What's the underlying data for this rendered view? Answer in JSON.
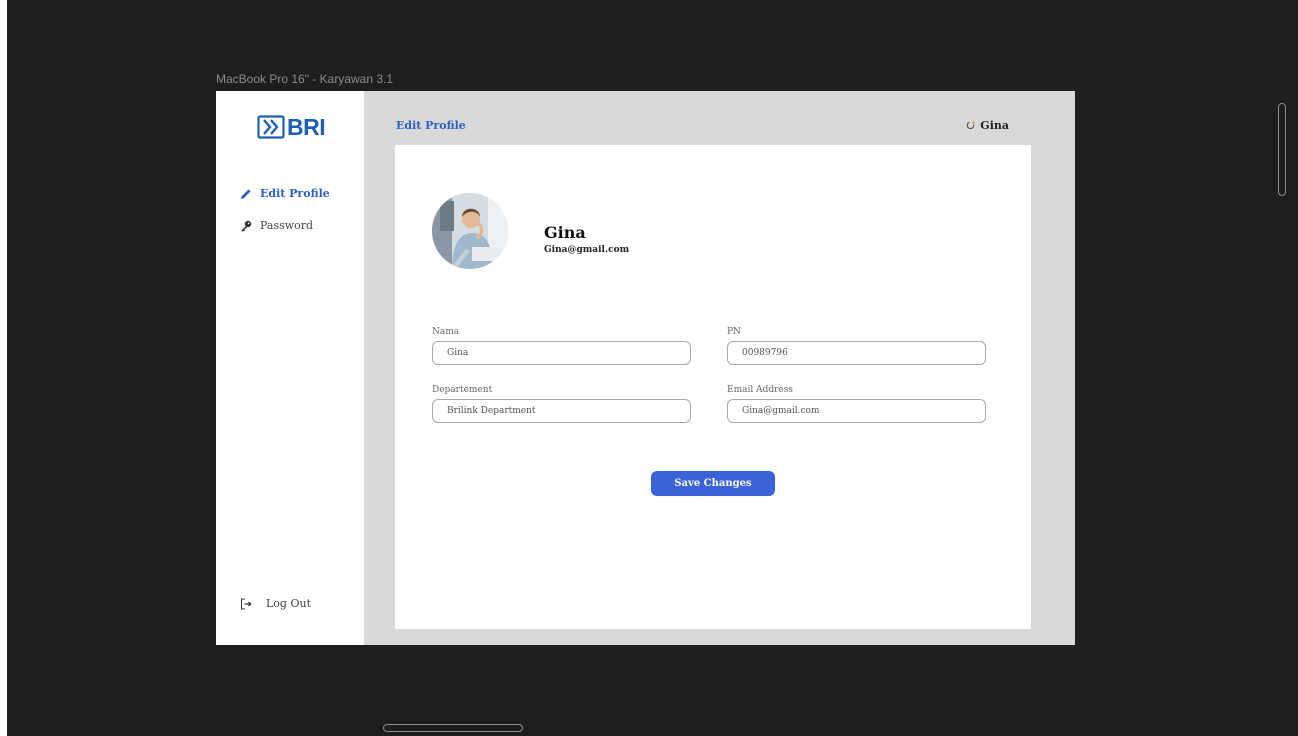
{
  "frame": {
    "title": "MacBook Pro 16\" - Karyawan 3.1"
  },
  "brand": {
    "name": "BRI",
    "logo_icon": "bri-logo-icon",
    "color": "#1d5fb4"
  },
  "sidebar": {
    "items": [
      {
        "label": "Edit Profile",
        "icon": "pencil-icon",
        "active": true
      },
      {
        "label": "Password",
        "icon": "key-icon",
        "active": false
      }
    ],
    "logout": {
      "label": "Log Out",
      "icon": "logout-icon"
    }
  },
  "header": {
    "title": "Edit Profile",
    "user_name": "Gina",
    "user_icon": "user-refresh-icon"
  },
  "profile": {
    "name": "Gina",
    "email": "Gina@gmail.com",
    "avatar_icon": "avatar-photo"
  },
  "form": {
    "nama": {
      "label": "Nama",
      "value": "Gina"
    },
    "pn": {
      "label": "PN",
      "value": "00989796"
    },
    "departement": {
      "label": "Departement",
      "value": "Brilink Department"
    },
    "email": {
      "label": "Email Address",
      "value": "Gina@gmail.com"
    },
    "save_label": "Save Changes"
  },
  "colors": {
    "accent": "#3b63d8",
    "frame_background": "#d9d9d9",
    "canvas_background": "#1e1e1e"
  }
}
